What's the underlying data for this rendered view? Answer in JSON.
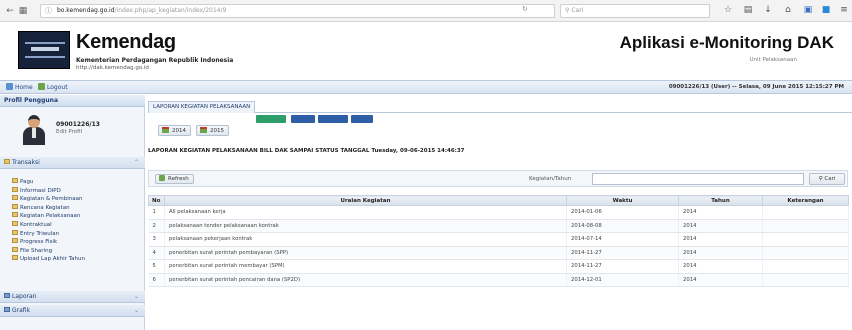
{
  "browser": {
    "url_host": "bo.kemendag.go.id",
    "url_path": "/index.php/ap_kegiatan/index/2014/9",
    "search_placeholder": "Cari"
  },
  "header": {
    "site_title": "Kemendag",
    "site_subtitle": "Kementerian Perdagangan Republik Indonesia",
    "site_url": "http://dak.kemendag.go.id",
    "app_title": "Aplikasi e-Monitoring DAK",
    "app_subtitle": "Unit Pelaksanaan"
  },
  "menu": {
    "home_label": "Home",
    "logout_label": "Logout",
    "user_status": "09001226/13 (User) -- Selasa, 09 June 2015 12:15:27 PM"
  },
  "sidebar": {
    "profile_header": "Profil Pengguna",
    "profile_id": "09001226/13",
    "profile_edit": "Edit Profil",
    "transaksi_header": "Transaksi",
    "items": [
      {
        "label": "Pagu"
      },
      {
        "label": "Informasi DIPD"
      },
      {
        "label": "Kegiatan & Pembinaan"
      },
      {
        "label": "Rencana Kegiatan"
      },
      {
        "label": "Kegiatan Pelaksanaan"
      },
      {
        "label": "Kontraktual"
      },
      {
        "label": "Entry Triwulan"
      },
      {
        "label": "Progress Fisik"
      },
      {
        "label": "File Sharing"
      },
      {
        "label": "Upload Lap Akhir Tahun"
      }
    ],
    "laporan_header": "Laporan",
    "grafik_header": "Grafik"
  },
  "main": {
    "tab_label": "LAPORAN KEGIATAN PELAKSANAAN",
    "year_buttons": [
      "2014",
      "2015"
    ],
    "report_title": "LAPORAN KEGIATAN PELAKSANAAN BILL DAK SAMPAI STATUS TANGGAL Tuesday, 09-06-2015 14:46:37",
    "refresh_label": "Refresh",
    "search_label": "Kegiatan/Tahun",
    "search_value": "",
    "search_button": "Cari",
    "columns": [
      "No",
      "Uraian Kegiatan",
      "Waktu",
      "Tahun",
      "Keterangan"
    ],
    "rows": [
      {
        "no": "1",
        "uraian": "All pelaksanaan kerja",
        "waktu": "2014-01-06",
        "tahun": "2014",
        "ket": ""
      },
      {
        "no": "2",
        "uraian": "pelaksanaan tender pelaksanaan kontrak",
        "waktu": "2014-08-08",
        "tahun": "2014",
        "ket": ""
      },
      {
        "no": "3",
        "uraian": "pelaksanaan pekerjaan kontrak",
        "waktu": "2014-07-14",
        "tahun": "2014",
        "ket": ""
      },
      {
        "no": "4",
        "uraian": "penerbitan surat perintah pembayaran (SPP)",
        "waktu": "2014-11-27",
        "tahun": "2014",
        "ket": ""
      },
      {
        "no": "5",
        "uraian": "penerbitan surat perintah membayar (SPM)",
        "waktu": "2014-11-27",
        "tahun": "2014",
        "ket": ""
      },
      {
        "no": "6",
        "uraian": "penerbitan surat perintah pencairan dana (SP2D)",
        "waktu": "2014-12-01",
        "tahun": "2014",
        "ket": ""
      }
    ]
  },
  "colors": {
    "accent_blue": "#2f5ea8",
    "accent_green": "#2e9e6a",
    "menu_bar": "#d9e4f2"
  }
}
